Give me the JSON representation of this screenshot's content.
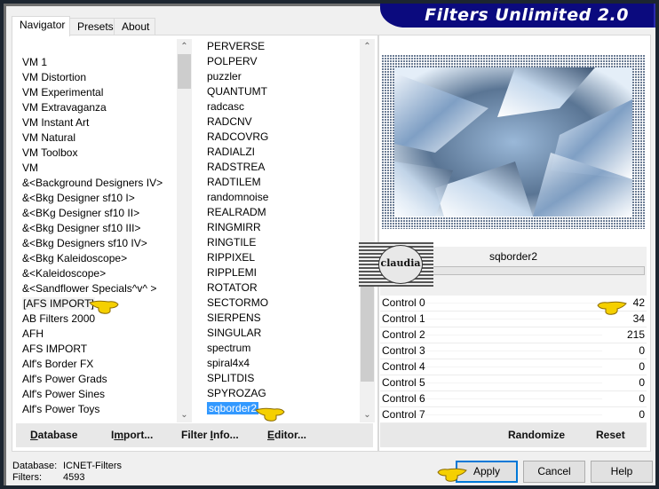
{
  "window": {
    "title": "Filters Unlimited 2.0"
  },
  "tabs": [
    {
      "label": "Navigator",
      "active": true
    },
    {
      "label": "Presets",
      "active": false
    },
    {
      "label": "About",
      "active": false
    }
  ],
  "categories": {
    "items": [
      "VM 1",
      "VM Distortion",
      "VM Experimental",
      "VM Extravaganza",
      "VM Instant Art",
      "VM Natural",
      "VM Toolbox",
      "VM",
      "&<Background Designers IV>",
      "&<Bkg Designer sf10 I>",
      "&<BKg Designer sf10 II>",
      "&<Bkg Designer sf10 III>",
      "&<Bkg Designers sf10 IV>",
      "&<Bkg Kaleidoscope>",
      "&<Kaleidoscope>",
      "&<Sandflower Specials^v^ >",
      "[AFS IMPORT]",
      "AB Filters 2000",
      "AFH",
      "AFS IMPORT",
      "Alf's Border FX",
      "Alf's Power Grads",
      "Alf's Power Sines",
      "Alf's Power Toys"
    ],
    "selected": "[AFS IMPORT]",
    "scroll_position": 0.02
  },
  "filters": {
    "items": [
      "PERVERSE",
      "POLPERV",
      "puzzler",
      "QUANTUMT",
      "radcasc",
      "RADCNV",
      "RADCOVRG",
      "RADIALZI",
      "RADSTREA",
      "RADTILEM",
      "randomnoise",
      "REALRADM",
      "RINGMIRR",
      "RINGTILE",
      "RIPPIXEL",
      "RIPPLEMI",
      "ROTATOR",
      "SECTORMO",
      "SIERPENS",
      "SINGULAR",
      "spectrum",
      "spiral4x4",
      "SPLITDIS",
      "SPYROZAG",
      "sqborder2"
    ],
    "selected": "sqborder2",
    "scroll_position": 0.9
  },
  "preview": {
    "filter_name": "sqborder2",
    "watermark": "claudia"
  },
  "controls": [
    {
      "label": "Control 0",
      "value": "42",
      "fraction": 0.165
    },
    {
      "label": "Control 1",
      "value": "34",
      "fraction": 0.133
    },
    {
      "label": "Control 2",
      "value": "215",
      "fraction": 0.843
    },
    {
      "label": "Control 3",
      "value": "0",
      "fraction": 0
    },
    {
      "label": "Control 4",
      "value": "0",
      "fraction": 0
    },
    {
      "label": "Control 5",
      "value": "0",
      "fraction": 0
    },
    {
      "label": "Control 6",
      "value": "0",
      "fraction": 0
    },
    {
      "label": "Control 7",
      "value": "0",
      "fraction": 0
    }
  ],
  "left_buttons": {
    "database": {
      "pre": "",
      "u": "D",
      "post": "atabase"
    },
    "import": {
      "pre": "I",
      "u": "m",
      "post": "port..."
    },
    "filter_info": {
      "pre": "Filter ",
      "u": "I",
      "post": "nfo..."
    },
    "editor": {
      "pre": "",
      "u": "E",
      "post": "ditor..."
    }
  },
  "right_buttons": {
    "randomize": "Randomize",
    "reset": "Reset"
  },
  "status": {
    "database_label": "Database:",
    "database_value": "ICNET-Filters",
    "filters_label": "Filters:",
    "filters_value": "4593"
  },
  "dialog_buttons": {
    "apply": "Apply",
    "cancel": "Cancel",
    "help": "Help"
  },
  "colors": {
    "banner": "#0b0a7e",
    "selection": "#3399ff",
    "default_button_border": "#0078d7",
    "pointer_hand": "#f5d000"
  }
}
